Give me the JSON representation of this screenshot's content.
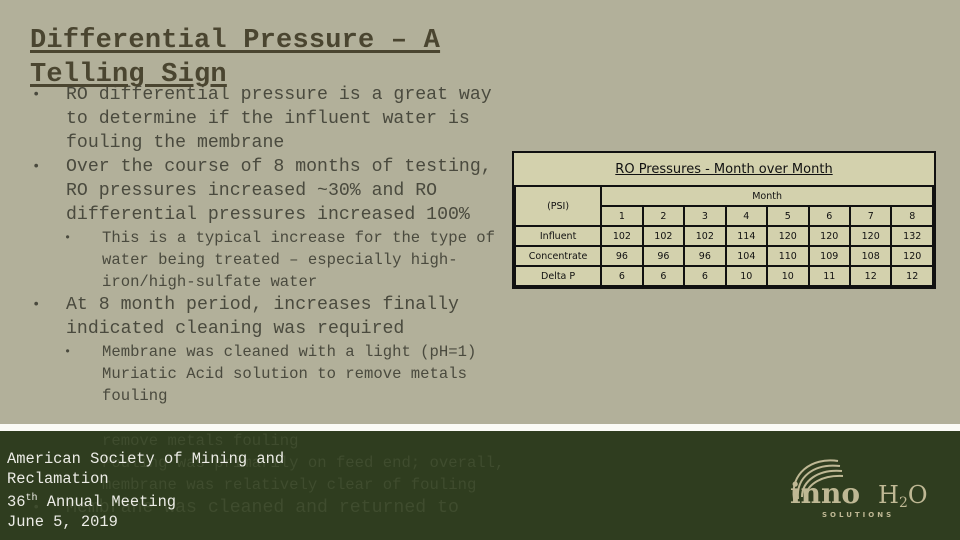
{
  "slide": {
    "title": "Differential Pressure – A Telling Sign",
    "bullets": [
      {
        "level": 1,
        "text": "RO differential pressure is a great way to determine if the influent water is fouling the membrane"
      },
      {
        "level": 1,
        "text": "Over the course of 8 months of testing, RO pressures increased ~30% and RO differential pressures increased 100%"
      },
      {
        "level": 2,
        "text": "This is a typical increase for the type of water being treated – especially high-iron/high-sulfate water"
      },
      {
        "level": 1,
        "text": "At 8 month period, increases finally indicated cleaning was required"
      },
      {
        "level": 2,
        "text": "Membrane was cleaned with a light (pH=1) Muriatic Acid solution to remove metals fouling"
      }
    ],
    "overflow_bullets": [
      {
        "level": 2,
        "text": "remove metals fouling"
      },
      {
        "level": 2,
        "text": "Fouling was primarily on feed end; overall, membrane was relatively clear of fouling"
      },
      {
        "level": 1,
        "text": "Membrane was cleaned and returned to"
      }
    ],
    "bullet_glyph": "•"
  },
  "table": {
    "title": "RO Pressures - Month over Month",
    "unit_label": "(PSI)",
    "group_header": "Month",
    "months": [
      "1",
      "2",
      "3",
      "4",
      "5",
      "6",
      "7",
      "8"
    ],
    "rows": [
      {
        "label": "Influent",
        "values": [
          "102",
          "102",
          "102",
          "114",
          "120",
          "120",
          "120",
          "132"
        ]
      },
      {
        "label": "Concentrate",
        "values": [
          "96",
          "96",
          "96",
          "104",
          "110",
          "109",
          "108",
          "120"
        ]
      },
      {
        "label": "Delta P",
        "values": [
          "6",
          "6",
          "6",
          "10",
          "10",
          "11",
          "12",
          "12"
        ]
      }
    ]
  },
  "footer": {
    "org_line1": "American Society of Mining and",
    "org_line2": "Reclamation",
    "meeting_num": "36",
    "meeting_sup": "th",
    "meeting_rest": " Annual Meeting",
    "date": "June 5, 2019",
    "logo_main": "innoH2O",
    "logo_sub": "SOLUTIONS"
  },
  "colors": {
    "slide_bg": "#b2b09a",
    "title": "#4a4530",
    "footer_bg": "#2f3d1f",
    "table_bg": "#d3d1ad",
    "logo": "#bfb894"
  }
}
